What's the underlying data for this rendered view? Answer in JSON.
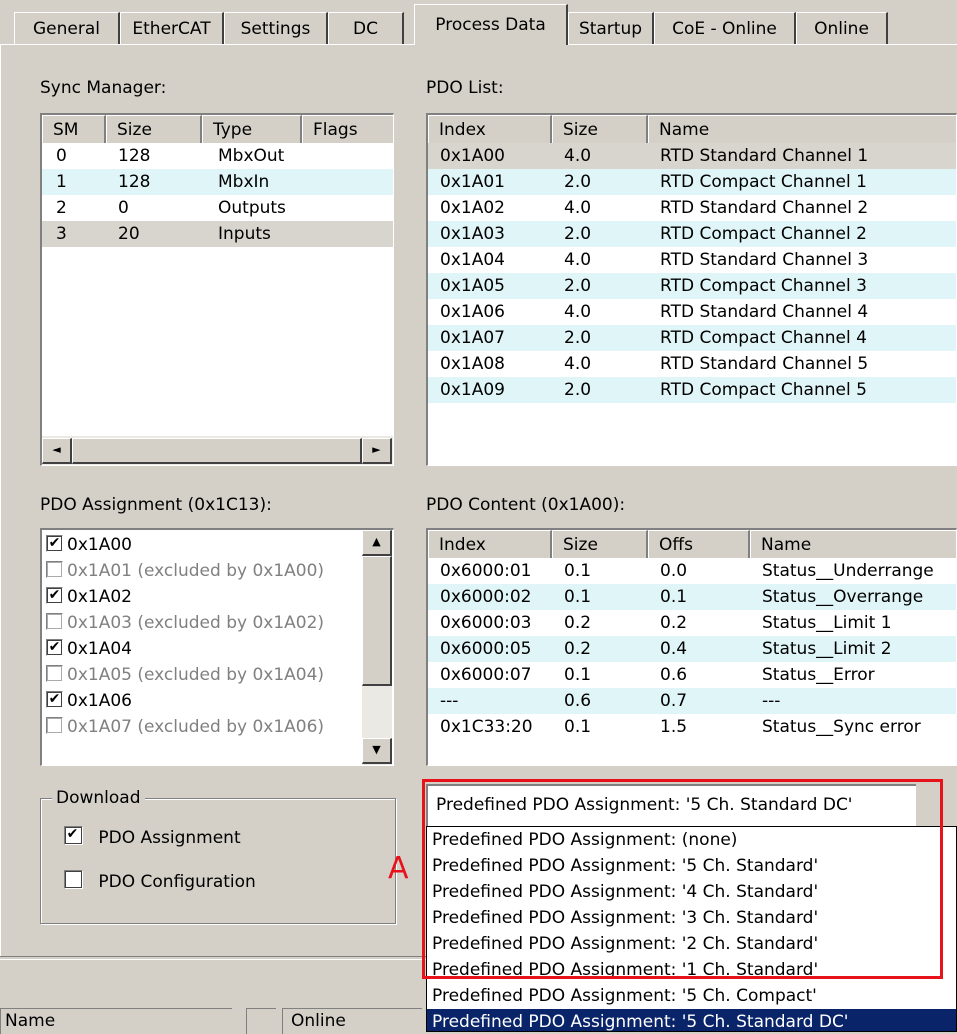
{
  "tabs": [
    "General",
    "EtherCAT",
    "Settings",
    "DC",
    "Process Data",
    "Startup",
    "CoE - Online",
    "Online"
  ],
  "sync_manager": {
    "label": "Sync Manager:",
    "columns": [
      "SM",
      "Size",
      "Type",
      "Flags"
    ],
    "rows": [
      {
        "sm": "0",
        "size": "128",
        "type": "MbxOut",
        "flags": ""
      },
      {
        "sm": "1",
        "size": "128",
        "type": "MbxIn",
        "flags": ""
      },
      {
        "sm": "2",
        "size": "0",
        "type": "Outputs",
        "flags": ""
      },
      {
        "sm": "3",
        "size": "20",
        "type": "Inputs",
        "flags": ""
      }
    ],
    "scroll_left_icon": "◄",
    "scroll_right_icon": "►"
  },
  "pdo_list": {
    "label": "PDO List:",
    "columns": [
      "Index",
      "Size",
      "Name"
    ],
    "rows": [
      {
        "index": "0x1A00",
        "size": "4.0",
        "name": "RTD Standard Channel 1"
      },
      {
        "index": "0x1A01",
        "size": "2.0",
        "name": "RTD Compact Channel 1"
      },
      {
        "index": "0x1A02",
        "size": "4.0",
        "name": "RTD Standard Channel 2"
      },
      {
        "index": "0x1A03",
        "size": "2.0",
        "name": "RTD Compact Channel 2"
      },
      {
        "index": "0x1A04",
        "size": "4.0",
        "name": "RTD Standard Channel 3"
      },
      {
        "index": "0x1A05",
        "size": "2.0",
        "name": "RTD Compact Channel 3"
      },
      {
        "index": "0x1A06",
        "size": "4.0",
        "name": "RTD Standard Channel 4"
      },
      {
        "index": "0x1A07",
        "size": "2.0",
        "name": "RTD Compact Channel 4"
      },
      {
        "index": "0x1A08",
        "size": "4.0",
        "name": "RTD Standard Channel 5"
      },
      {
        "index": "0x1A09",
        "size": "2.0",
        "name": "RTD Compact Channel 5"
      }
    ]
  },
  "pdo_assignment": {
    "label": "PDO Assignment (0x1C13):",
    "items": [
      {
        "text": "0x1A00",
        "checked": true
      },
      {
        "text": "0x1A01 (excluded by 0x1A00)",
        "checked": false
      },
      {
        "text": "0x1A02",
        "checked": true
      },
      {
        "text": "0x1A03 (excluded by 0x1A02)",
        "checked": false
      },
      {
        "text": "0x1A04",
        "checked": true
      },
      {
        "text": "0x1A05 (excluded by 0x1A04)",
        "checked": false
      },
      {
        "text": "0x1A06",
        "checked": true
      },
      {
        "text": "0x1A07 (excluded by 0x1A06)",
        "checked": false
      }
    ],
    "scroll_up_icon": "▲",
    "scroll_down_icon": "▼"
  },
  "pdo_content": {
    "label": "PDO Content (0x1A00):",
    "columns": [
      "Index",
      "Size",
      "Offs",
      "Name"
    ],
    "rows": [
      {
        "index": "0x6000:01",
        "size": "0.1",
        "offs": "0.0",
        "name": "Status__Underrange"
      },
      {
        "index": "0x6000:02",
        "size": "0.1",
        "offs": "0.1",
        "name": "Status__Overrange"
      },
      {
        "index": "0x6000:03",
        "size": "0.2",
        "offs": "0.2",
        "name": "Status__Limit 1"
      },
      {
        "index": "0x6000:05",
        "size": "0.2",
        "offs": "0.4",
        "name": "Status__Limit 2"
      },
      {
        "index": "0x6000:07",
        "size": "0.1",
        "offs": "0.6",
        "name": "Status__Error"
      },
      {
        "index": "---",
        "size": "0.6",
        "offs": "0.7",
        "name": "---"
      },
      {
        "index": "0x1C33:20",
        "size": "0.1",
        "offs": "1.5",
        "name": "Status__Sync error"
      }
    ]
  },
  "download": {
    "title": "Download",
    "pdo_assignment_label": "PDO Assignment",
    "pdo_assignment_checked": true,
    "pdo_configuration_label": "PDO Configuration",
    "pdo_configuration_checked": false
  },
  "annotation_letter": "A",
  "annotation_color": "#e8121a",
  "predefined": {
    "selected": "Predefined PDO Assignment: '5 Ch. Standard DC'",
    "options": [
      "Predefined PDO Assignment: (none)",
      "Predefined PDO Assignment: '5 Ch. Standard'",
      "Predefined PDO Assignment: '4 Ch. Standard'",
      "Predefined PDO Assignment: '3 Ch. Standard'",
      "Predefined PDO Assignment: '2 Ch. Standard'",
      "Predefined PDO Assignment: '1 Ch. Standard'",
      "Predefined PDO Assignment: '5 Ch. Compact'",
      "Predefined PDO Assignment: '5 Ch. Standard DC'"
    ]
  },
  "statusbar": {
    "name": "Name",
    "online": "Online"
  }
}
